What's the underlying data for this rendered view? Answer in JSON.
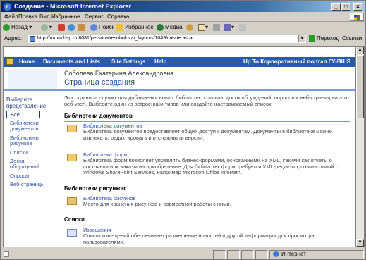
{
  "window": {
    "title": "Создание - Microsoft Internet Explorer",
    "min": "_",
    "max": "□",
    "close": "×"
  },
  "menu": [
    "Файл",
    "Правка",
    "Вид",
    "Избранное",
    "Сервис",
    "Справка"
  ],
  "toolbar": {
    "back": "Назад",
    "search": "Поиск",
    "favorites": "Избранное",
    "media": "Медиа"
  },
  "address": {
    "label": "Адрес:",
    "url": "http://mmm.hsp.ru:8081/personal/esobolova/_layouts/1049/create.aspx",
    "go": "Переход",
    "links": "Ссылки"
  },
  "sp_nav": {
    "home": "Home",
    "documents": "Documents and Lists",
    "settings": "Site Settings",
    "help": "Help",
    "up": "Up To Корпоративный портал ГУ-ВШЭ"
  },
  "header": {
    "owner": "Соболева Екатерина Александровна",
    "title": "Страница создания"
  },
  "quick": {
    "heading": "Выберите представление",
    "selected": "Все",
    "items": [
      "Библиотеки документов",
      "Библиотеки рисунков",
      "Списки",
      "Доски обсуждений",
      "Опросы",
      "Веб-страницы"
    ]
  },
  "main": {
    "intro": "Эта страница служит для добавления новых библиотек, списков, досок обсуждений, опросов и веб-страниц на этот веб-узел. Выберите один из встроенных типов или создайте настраиваемый список.",
    "sections": [
      {
        "title": "Библиотеки документов",
        "items": [
          {
            "name": "Библиотека документов",
            "desc": "Библиотека документов предоставляет общий доступ к документам. Документы в библиотеке можно извлекать, редактировать и отслеживать версии."
          },
          {
            "name": "Библиотека форм",
            "desc": "Библиотека форм позволяет управлять бизнес-формами, основанными на XML, такими как отчеты о состоянии или заказы на приобретение. Для библиотек форм требуется XML-редактор, совместимый с Windows SharePoint Services, например Microsoft Office InfoPath."
          }
        ]
      },
      {
        "title": "Библиотеки рисунков",
        "items": [
          {
            "name": "Библиотека рисунков",
            "desc": "Место для хранения рисунков и совместной работы с ними."
          }
        ]
      },
      {
        "title": "Списки",
        "items": [
          {
            "name": "Извещения",
            "desc": "Список извещений обеспечивает размещение новостей и другой информации для просмотра пользователями."
          }
        ]
      }
    ]
  },
  "status": {
    "zone": "Интернет"
  }
}
